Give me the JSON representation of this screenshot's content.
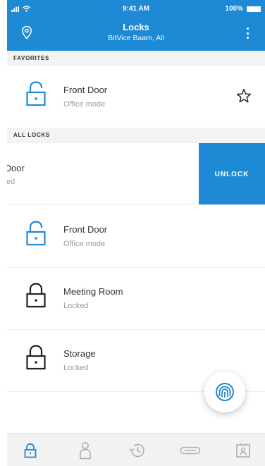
{
  "status_bar": {
    "time": "9:41 AM",
    "battery": "100%"
  },
  "header": {
    "title": "Locks",
    "subtitle": "BitVice Baam, All"
  },
  "sections": {
    "favorites": "FAVORITES",
    "all_locks": "ALL LOCKS"
  },
  "favorites": [
    {
      "name": "Front Door",
      "status": "Office mode",
      "icon": "lock-open-icon"
    }
  ],
  "swiped_item": {
    "name_partial": "ck Door",
    "status_partial": "cked",
    "action_label": "UNLOCK"
  },
  "locks": [
    {
      "name": "Front Door",
      "status": "Office mode",
      "icon": "lock-open-icon"
    },
    {
      "name": "Meeting Room",
      "status": "Locked",
      "icon": "lock-closed-icon"
    },
    {
      "name": "Storage",
      "status": "Locked",
      "icon": "lock-closed-icon"
    }
  ],
  "tabs": [
    "lock-icon",
    "person-icon",
    "history-icon",
    "key-card-icon",
    "badge-icon"
  ],
  "colors": {
    "accent": "#1e8ad6",
    "muted": "#9a9a9a",
    "locked_icon": "#222222"
  }
}
